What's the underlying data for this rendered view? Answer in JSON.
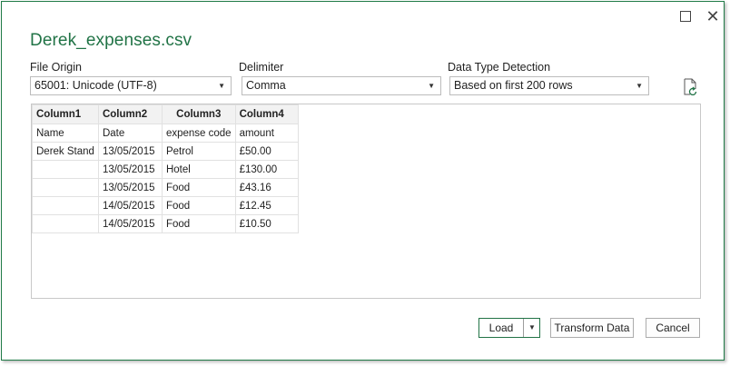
{
  "dialog": {
    "title": "Derek_expenses.csv"
  },
  "window_controls": {
    "maximize_icon": "maximize-icon",
    "close_icon": "close-icon",
    "close_glyph": "✕"
  },
  "options": {
    "file_origin": {
      "label": "File Origin",
      "value": "65001: Unicode (UTF-8)"
    },
    "delimiter": {
      "label": "Delimiter",
      "value": "Comma"
    },
    "data_type_detection": {
      "label": "Data Type Detection",
      "value": "Based on first 200 rows"
    },
    "refresh_icon": "refresh-document-icon"
  },
  "preview": {
    "columns": [
      "Column1",
      "Column2",
      "Column3",
      "Column4"
    ],
    "rows": [
      [
        "Name",
        "Date",
        "expense code",
        "amount"
      ],
      [
        "Derek Stand",
        "13/05/2015",
        "Petrol",
        "£50.00"
      ],
      [
        "",
        "13/05/2015",
        "Hotel",
        "£130.00"
      ],
      [
        "",
        "13/05/2015",
        "Food",
        "£43.16"
      ],
      [
        "",
        "14/05/2015",
        "Food",
        "£12.45"
      ],
      [
        "",
        "14/05/2015",
        "Food",
        "£10.50"
      ]
    ]
  },
  "buttons": {
    "load": "Load",
    "transform": "Transform Data",
    "cancel": "Cancel"
  },
  "colors": {
    "accent": "#217346",
    "border": "#bcbcbc"
  }
}
